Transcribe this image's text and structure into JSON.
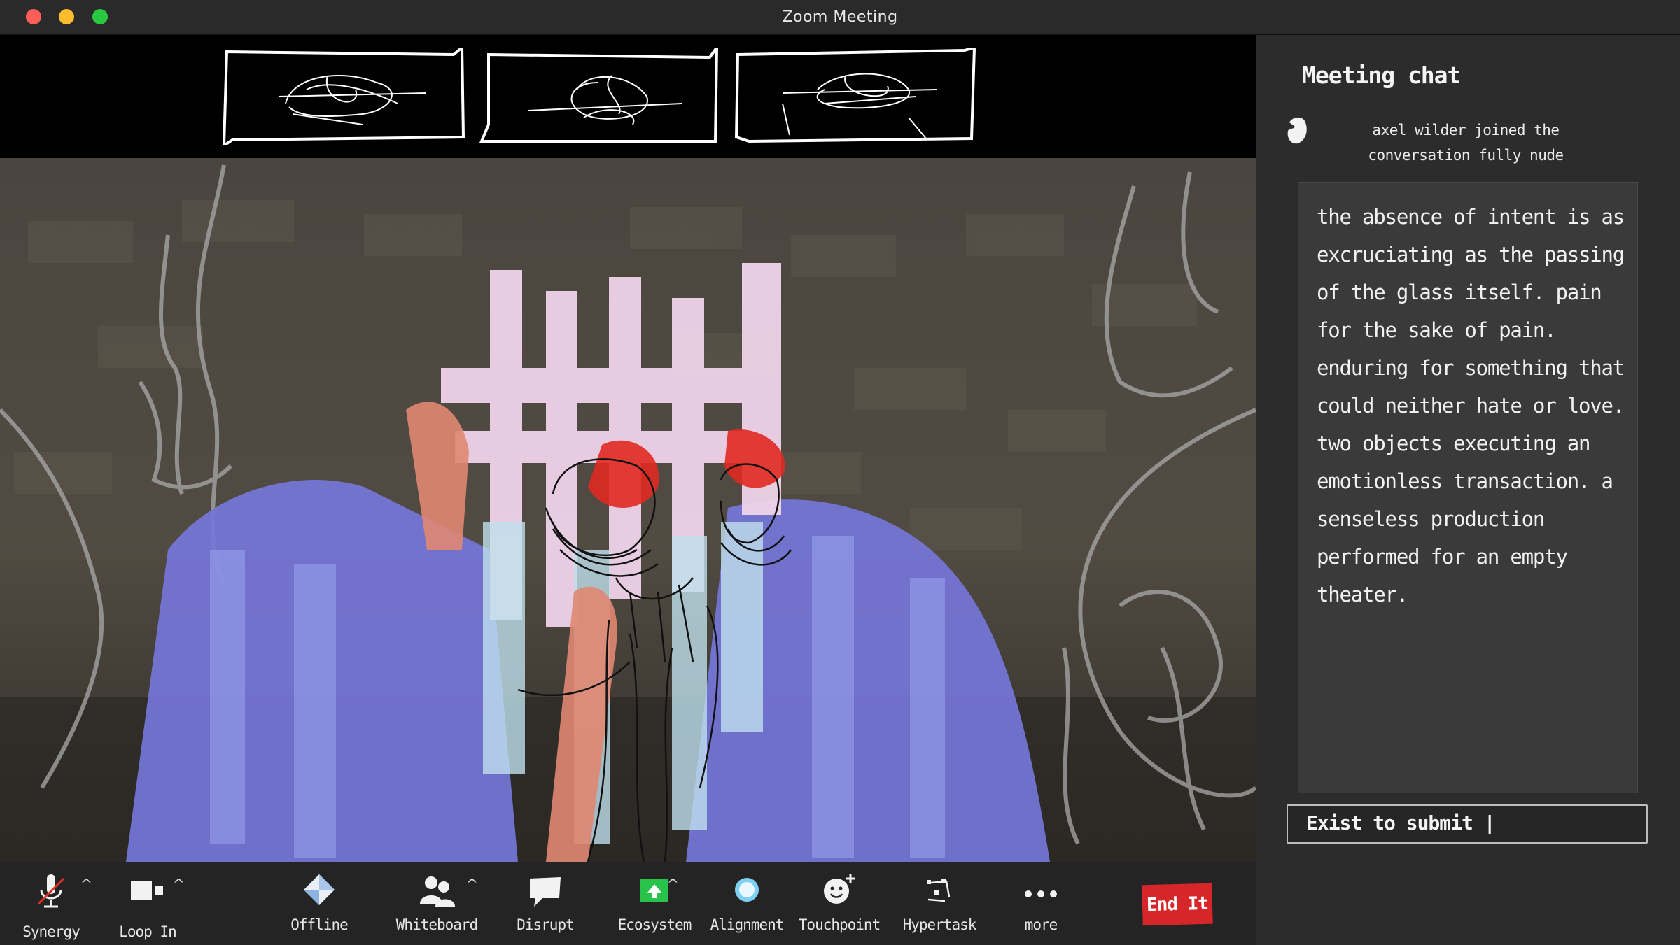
{
  "window": {
    "title": "Zoom Meeting"
  },
  "chat": {
    "title": "Meeting chat",
    "system_message": "axel wilder joined the conversation fully nude",
    "message": "the absence of intent is as excruciating as the passing of the glass itself. pain for the sake of pain. enduring for something that could neither hate or love. two objects executing an emotionless transaction. a senseless production performed for an empty theater.",
    "input_value": "Exist to submit |"
  },
  "toolbar": {
    "synergy_label": "Synergy",
    "loopin_label": "Loop In",
    "offline_label": "Offline",
    "whiteboard_label": "Whiteboard",
    "disrupt_label": "Disrupt",
    "ecosystem_label": "Ecosystem",
    "alignment_label": "Alignment",
    "touchpoint_label": "Touchpoint",
    "hypertask_label": "Hypertask",
    "more_label": "more",
    "caret": "^",
    "end_label": "End It"
  },
  "colors": {
    "end_button": "#d6262a",
    "ecosystem_icon": "#29c24a",
    "alignment_icon": "#7fd0f5",
    "titlebar": "#2a2a2a"
  },
  "icons": {
    "synergy": "microphone-muted-icon",
    "loopin": "video-camera-icon",
    "offline": "diamond-arrows-icon",
    "whiteboard": "participants-icon",
    "disrupt": "speech-bubble-icon",
    "ecosystem": "share-screen-icon",
    "alignment": "circle-icon",
    "touchpoint": "smiley-plus-icon",
    "hypertask": "apps-icon",
    "more": "dots-icon"
  }
}
